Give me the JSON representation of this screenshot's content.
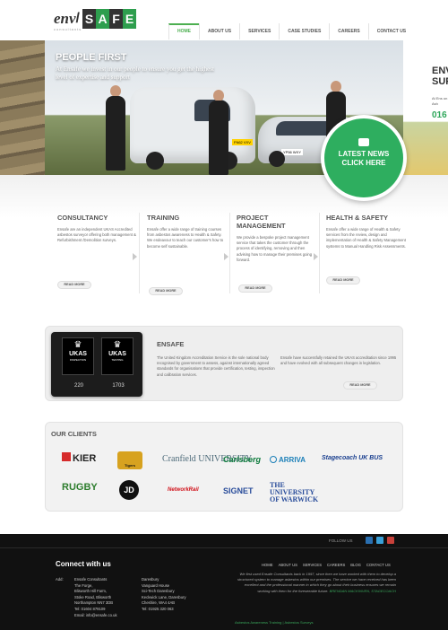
{
  "header": {
    "logo": {
      "env": "env",
      "safe_letters": [
        "S",
        "A",
        "F",
        "E"
      ],
      "sub": "consultants"
    },
    "nav": [
      {
        "label": "HOME",
        "active": true
      },
      {
        "label": "ABOUT US",
        "active": false
      },
      {
        "label": "SERVICES",
        "active": false
      },
      {
        "label": "CASE STUDIES",
        "active": false
      },
      {
        "label": "CAREERS",
        "active": false
      },
      {
        "label": "CONTACT US",
        "active": false
      }
    ]
  },
  "hero": {
    "title": "PEOPLE FIRST",
    "subtitle": "At Ensafe we invest in our people to ensure you get the highest level of expertise and support",
    "van_plate": "FN62 VXV",
    "car_plate": "YP56 WXY",
    "next_slide": {
      "title": "ENV SUP",
      "text": "At Ens on Ash",
      "phone": "016"
    },
    "news": {
      "line1": "LATEST NEWS",
      "line2": "CLICK HERE"
    }
  },
  "services": [
    {
      "title": "CONSULTANCY",
      "text": "Ensafe are an independent UKAS Accredited asbestos surveyor offering both management & Refurbishment /Demolition surveys.",
      "button": "READ MORE"
    },
    {
      "title": "TRAINING",
      "text": "Ensafe offer a wide range of training courses from asbestos awareness to Health & Safety. We endeavour to teach our customer's how to become self sustainable.",
      "button": "READ MORE"
    },
    {
      "title": "PROJECT MANAGEMENT",
      "text": "We provide a bespoke project management service that takes the customer through the process of identifying, removing and then advising how to manage their premises going forward.",
      "button": "READ MORE"
    },
    {
      "title": "HEALTH & SAFETY",
      "text": "Ensafe offer a wide range of Health & Safety services from the review, design and implementation of Health & Safety Management systems to Manual Handling Risk Assessments.",
      "button": "READ MORE"
    }
  ],
  "ensafe": {
    "title": "ENSAFE",
    "p1": "The United Kingdom Accreditation Service is the sole national body recognised by government to assess, against internationally agreed standards for organisations that provide certification, testing, inspection and calibration services.",
    "p2": "Ensafe have successfully retained the UKAS accreditation since 1995 and have evolved with all subsequent changes in legislation.",
    "button": "READ MORE",
    "badges": [
      {
        "title": "UKAS",
        "sub": "INSPECTION",
        "number": "220"
      },
      {
        "title": "UKAS",
        "sub": "TESTING",
        "number": "1703"
      }
    ]
  },
  "clients": {
    "title": "OUR CLIENTS",
    "logos": [
      "KIER",
      "Tigers",
      "Cranfield UNIVERSITY",
      "Carlsberg",
      "ARRIVA",
      "Stagecoach UK BUS",
      "RUGBY",
      "JD",
      "NetworkRail",
      "SIGNET",
      "THE UNIVERSITY OF WARWICK"
    ],
    "colors": {
      "kier_red": "#d62b2b",
      "arriva_blue": "#1b7fb8",
      "stagecoach_blue": "#1a3f8f",
      "rugby_green": "#2d7d2d",
      "network_rail": "#d1121b",
      "warwick_blue": "#2a4d9b",
      "carlsberg_green": "#0b7a3b"
    }
  },
  "footer": {
    "follow_label": "FOLLOW US",
    "heading": "Connect with us",
    "nav": [
      "HOME",
      "ABOUT US",
      "SERVICES",
      "CAREERS",
      "BLOG",
      "CONTACT US"
    ],
    "address_label": "Add:",
    "address1": [
      "Ensafe Consultants",
      "The Forge,",
      "Blisworth Hill Farm,",
      "Stoke Road, Blisworth",
      "Northampton NN7 3DB",
      "Tel: 01604 879109",
      "Email: info@ensafe.co.uk"
    ],
    "address2": [
      "Daresbury",
      "Vanguard House",
      "Sci-Tech Daresbury",
      "Keckwick Lane, Daresbury",
      "Cheshire, WA4 4AB",
      "Tel: 01925 320 063"
    ],
    "quote": "We first used Ensafe Consultants back in 1997, since then we have worked with them to develop a structured system to manage asbestos within our premises. The service we have received has been excellent and the professional manner in which they go about their business ensures we remain working with them for the foreseeable future.",
    "quote_author": "BRENDAN MACKINVEN, STAGECOACH",
    "links": "Asbestos Awareness Training | Asbestos Surveys"
  },
  "colors": {
    "accent_green": "#2eae5f",
    "logo_green": "#2e9e4e",
    "logo_dark": "#333333"
  }
}
